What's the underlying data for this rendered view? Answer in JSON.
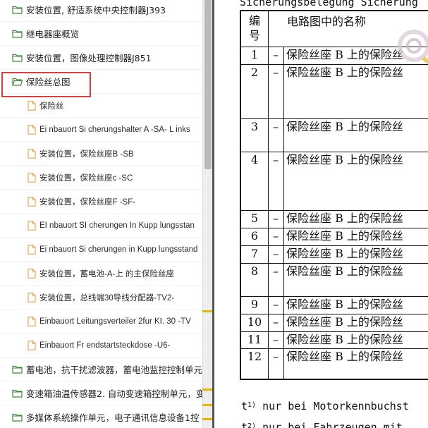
{
  "tree": {
    "items": [
      {
        "type": "folder",
        "level": 0,
        "label": "安装位置, 舒适系统中央控制器J393"
      },
      {
        "type": "folder",
        "level": 0,
        "label": "继电器座概览"
      },
      {
        "type": "folder",
        "level": 0,
        "label": "安装位置，图像处理控制器J851"
      },
      {
        "type": "folder",
        "level": 0,
        "label": "保险丝总图",
        "selected": true
      },
      {
        "type": "file",
        "level": 1,
        "label": "保险丝"
      },
      {
        "type": "file",
        "level": 1,
        "label": "Ei nbauort Si cherungshalter A -SA- L inks"
      },
      {
        "type": "file",
        "level": 1,
        "label": "安装位置，保险丝座B -SB"
      },
      {
        "type": "file",
        "level": 1,
        "label": "安装位置，保险丝座c -SC"
      },
      {
        "type": "file",
        "level": 1,
        "label": "安装位置，保险丝座F -SF-"
      },
      {
        "type": "file",
        "level": 1,
        "label": "EI nbauort SI cherungen In Kupp lungsstan"
      },
      {
        "type": "file",
        "level": 1,
        "label": "Ei nbauort Si cherungen in Kupp lungsstand"
      },
      {
        "type": "file",
        "level": 1,
        "label": "安装位置，蓄电池-A-上 的主保险丝座"
      },
      {
        "type": "file",
        "level": 1,
        "label": "安装位置，总线端30导线分配器-TV2-"
      },
      {
        "type": "file",
        "level": 1,
        "label": "Einbauort Leitungsverteiler 2fur KI. 30 -TV"
      },
      {
        "type": "file",
        "level": 1,
        "label": "Einbauort Fr endstartsteckdose -U6-"
      },
      {
        "type": "folder",
        "level": 0,
        "label": "蓄电池，抗干扰滤波器，蓄电池监控控制单元"
      },
      {
        "type": "folder",
        "level": 0,
        "label": "变速箱油温传感器2. 自动变速箱控制单元，变"
      },
      {
        "type": "folder",
        "level": 0,
        "label": "多媒体系统操作单元，电子通讯信息设备1控"
      }
    ]
  },
  "document": {
    "title": "Sicherungsbelegung Sicherung",
    "table": {
      "header": {
        "num": "编号",
        "name": "电路图中的名称"
      },
      "rows": [
        {
          "num": "1",
          "dash": "–",
          "name": "保险丝座 B 上的保险丝"
        },
        {
          "num": "2",
          "dash": "–",
          "name": "保险丝座 B 上的保险丝"
        },
        {
          "num": "3",
          "dash": "–",
          "name": "保险丝座 B 上的保险丝"
        },
        {
          "num": "4",
          "dash": "–",
          "name": "保险丝座 B 上的保险丝"
        },
        {
          "num": "5",
          "dash": "–",
          "name": "保险丝座 B 上的保险丝"
        },
        {
          "num": "6",
          "dash": "–",
          "name": "保险丝座 B 上的保险丝"
        },
        {
          "num": "7",
          "dash": "–",
          "name": "保险丝座 B 上的保险丝"
        },
        {
          "num": "8",
          "dash": "–",
          "name": "保险丝座 B 上的保险丝"
        },
        {
          "num": "9",
          "dash": "–",
          "name": "保险丝座 B 上的保险丝"
        },
        {
          "num": "10",
          "dash": "–",
          "name": "保险丝座 B 上的保险丝"
        },
        {
          "num": "11",
          "dash": "–",
          "name": "保险丝座 B 上的保险丝"
        },
        {
          "num": "12",
          "dash": "–",
          "name": "保险丝座 B 上的保险丝"
        }
      ]
    },
    "footnotes": [
      {
        "marker": "t",
        "sup": "1)",
        "text": "nur bei Motorkennbuchst"
      },
      {
        "marker": "t",
        "sup": "2)",
        "text": "nur bei Fahrzeugen mit"
      }
    ]
  },
  "colors": {
    "highlight": "#e03a3a",
    "folder_stroke": "#3f8a3f",
    "file_stroke": "#e0a24a",
    "scroll_mark": "#e8b400"
  }
}
